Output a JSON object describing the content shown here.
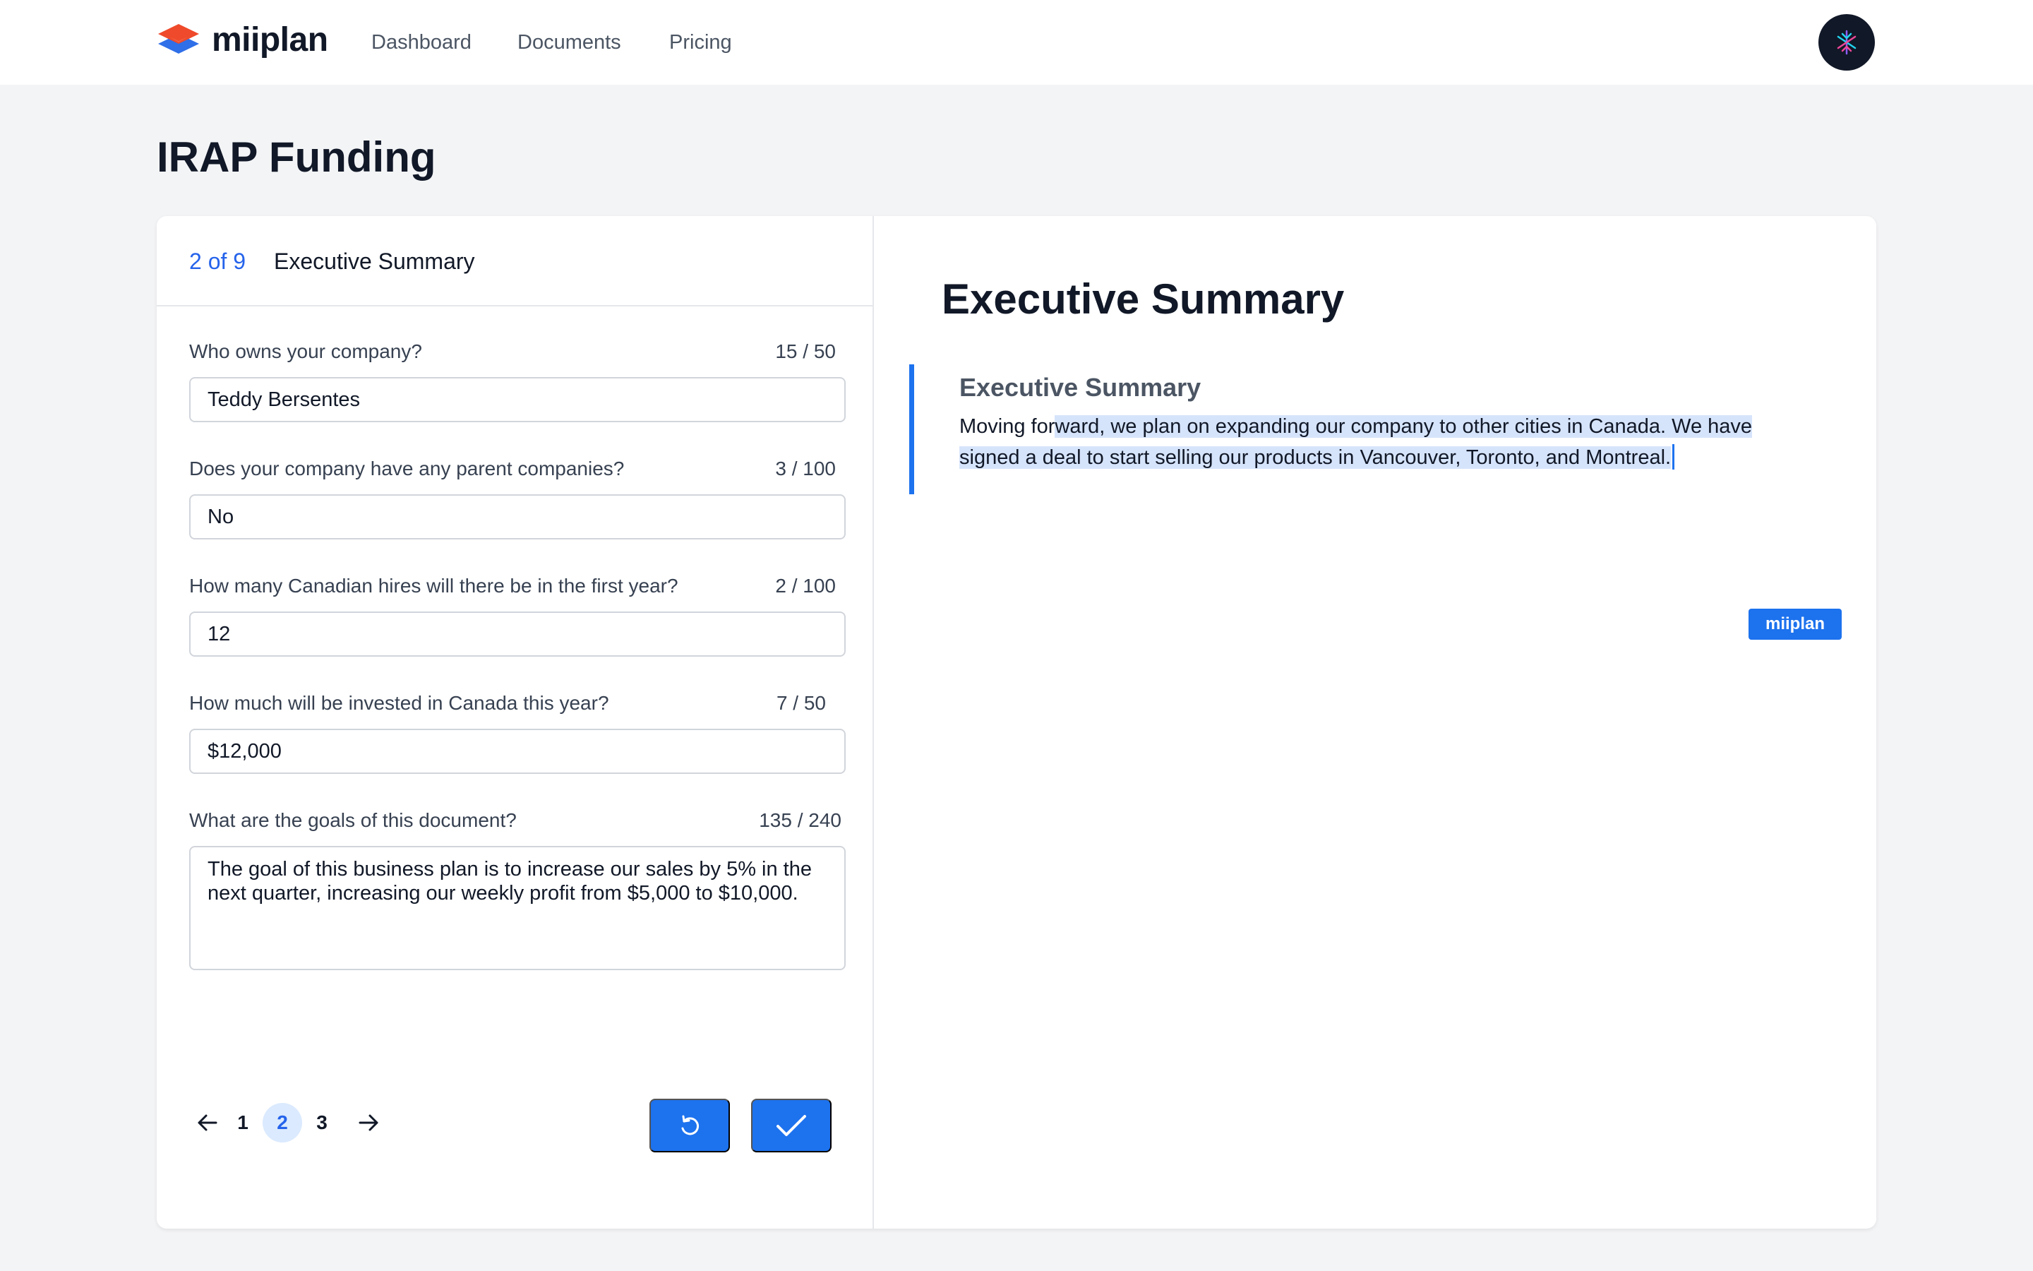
{
  "app": {
    "brand": "miiplan",
    "nav": [
      "Dashboard",
      "Documents",
      "Pricing"
    ]
  },
  "page": {
    "title": "IRAP Funding"
  },
  "form": {
    "step_counter": "2 of 9",
    "section_name": "Executive Summary",
    "fields": [
      {
        "label": "Who owns your company?",
        "count": "15 / 50",
        "value": "Teddy Bersentes"
      },
      {
        "label": "Does your company have any parent companies?",
        "count": "3 / 100",
        "value": "No"
      },
      {
        "label": "How many Canadian hires will there be in the first year?",
        "count": "2 / 100",
        "value": "12"
      },
      {
        "label": "How much will be invested in Canada this year?",
        "count": "7 / 50",
        "value": "$12,000"
      },
      {
        "label": "What are the goals of this document?",
        "count": "135 / 240",
        "value": "The goal of this business plan is to increase our sales by 5% in the next quarter, increasing our weekly profit from $5,000 to $10,000."
      }
    ],
    "pagination": {
      "pages": [
        "1",
        "2",
        "3"
      ],
      "current": "2"
    },
    "icons": {
      "prev": "arrow-left-icon",
      "next": "arrow-right-icon",
      "reset": "rotate-ccw-icon",
      "confirm": "check-icon"
    }
  },
  "preview": {
    "title": "Executive Summary",
    "heading": "Executive Summary",
    "body_unselected": "Moving for",
    "body_selected": "ward, we plan on expanding our company to other cities in Canada. We have signed a deal to start selling our products in Vancouver, Toronto, and Montreal.",
    "tag_label": "miiplan"
  },
  "colors": {
    "accent": "#1d72ee",
    "selection": "#d6e4fb",
    "logo_top": "#ef4a2b",
    "logo_bottom": "#2f6fe8"
  }
}
